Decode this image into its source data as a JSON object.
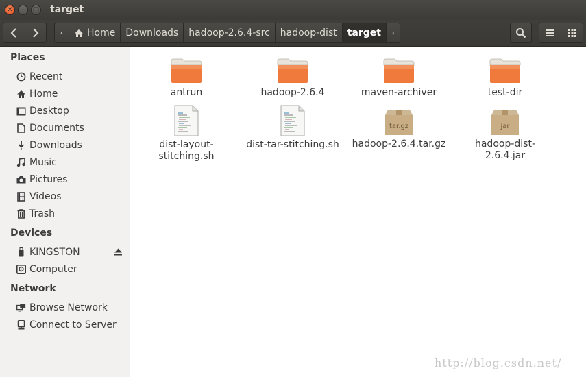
{
  "window": {
    "title": "target"
  },
  "toolbar": {
    "breadcrumbs": [
      "Home",
      "Downloads",
      "hadoop-2.6.4-src",
      "hadoop-dist",
      "target"
    ],
    "left_arrow": "‹",
    "right_arrow": "›",
    "search_icon": "search-icon",
    "menu_icon": "hamburger-menu-icon",
    "grid_icon": "grid-view-icon"
  },
  "sidebar": {
    "places_heading": "Places",
    "places": [
      {
        "label": "Recent",
        "icon": "clock-icon"
      },
      {
        "label": "Home",
        "icon": "home-icon"
      },
      {
        "label": "Desktop",
        "icon": "desktop-icon"
      },
      {
        "label": "Documents",
        "icon": "document-icon"
      },
      {
        "label": "Downloads",
        "icon": "download-icon"
      },
      {
        "label": "Music",
        "icon": "music-icon"
      },
      {
        "label": "Pictures",
        "icon": "camera-icon"
      },
      {
        "label": "Videos",
        "icon": "film-icon"
      },
      {
        "label": "Trash",
        "icon": "trash-icon"
      }
    ],
    "devices_heading": "Devices",
    "devices": [
      {
        "label": "KINGSTON",
        "icon": "usb-drive-icon"
      },
      {
        "label": "Computer",
        "icon": "harddisk-icon"
      }
    ],
    "network_heading": "Network",
    "network": [
      {
        "label": "Browse Network",
        "icon": "network-icon"
      },
      {
        "label": "Connect to Server",
        "icon": "server-icon"
      }
    ]
  },
  "files": [
    {
      "name": "antrun",
      "type": "folder"
    },
    {
      "name": "hadoop-2.6.4",
      "type": "folder"
    },
    {
      "name": "maven-archiver",
      "type": "folder"
    },
    {
      "name": "test-dir",
      "type": "folder"
    },
    {
      "name": "dist-layout-stitching.sh",
      "type": "script"
    },
    {
      "name": "dist-tar-stitching.sh",
      "type": "script"
    },
    {
      "name": "hadoop-2.6.4.tar.gz",
      "type": "archive",
      "badge": "tar.gz"
    },
    {
      "name": "hadoop-dist-2.6.4.jar",
      "type": "archive",
      "badge": "jar"
    }
  ],
  "watermark": "http://blog.csdn.net/"
}
